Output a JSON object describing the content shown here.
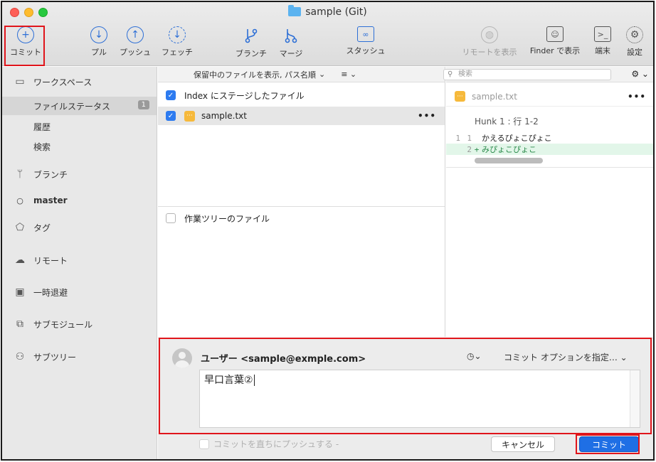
{
  "window": {
    "title": "sample (Git)"
  },
  "toolbar": {
    "commit": "コミット",
    "pull": "プル",
    "push": "プッシュ",
    "fetch": "フェッチ",
    "branch": "ブランチ",
    "merge": "マージ",
    "stash": "スタッシュ",
    "show_remote": "リモートを表示",
    "show_finder": "Finder で表示",
    "terminal": "端末",
    "settings": "設定"
  },
  "sidebar": {
    "workspace": "ワークスペース",
    "file_status": "ファイルステータス",
    "file_status_count": "1",
    "history": "履歴",
    "search": "検索",
    "branches": "ブランチ",
    "current_branch": "master",
    "tags": "タグ",
    "remotes": "リモート",
    "stashes": "一時退避",
    "submodules": "サブモジュール",
    "subtrees": "サブツリー"
  },
  "files": {
    "view_option": "保留中のファイルを表示, パス名順",
    "staged_header": "Index にステージしたファイル",
    "staged_file": "sample.txt",
    "unstaged_header": "作業ツリーのファイル"
  },
  "diff": {
    "search_placeholder": "検索",
    "file": "sample.txt",
    "hunk": "Hunk 1 : 行 1-2",
    "lines": [
      {
        "old": "1",
        "new": "1",
        "prefix": "",
        "text": "かえるぴょこぴょこ"
      },
      {
        "old": "",
        "new": "2",
        "prefix": "+",
        "text": "みぴょこぴょこ"
      }
    ]
  },
  "commit": {
    "user": "ユーザー <sample@exmple.com>",
    "options": "コミット オプションを指定…",
    "message": "早口言葉②",
    "push_immediately": "コミットを直ちにプッシュする -",
    "cancel": "キャンセル",
    "submit": "コミット"
  }
}
